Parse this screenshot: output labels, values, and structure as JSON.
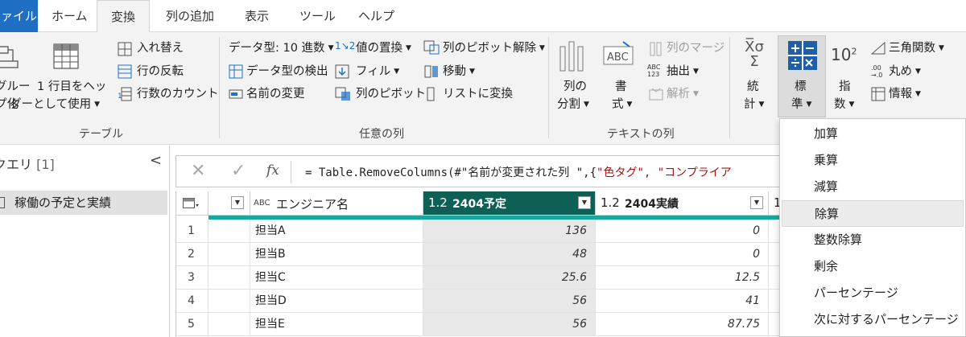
{
  "tabs": {
    "file": "ファイル",
    "home": "ホーム",
    "transform": "変換",
    "add_column": "列の追加",
    "view": "表示",
    "tools": "ツール",
    "help": "ヘルプ"
  },
  "ribbon": {
    "table_group": {
      "group_label": "テーブル",
      "group_rows_line1": "グルー",
      "group_rows_line2": "プ化",
      "use_first_row_line1": "1 行目をヘッ",
      "use_first_row_line2": "ダーとして使用",
      "transpose": "入れ替え",
      "reverse_rows": "行の反転",
      "count_rows": "行数のカウント"
    },
    "any_column_group": {
      "group_label": "任意の列",
      "data_type": "データ型: 10 進数",
      "detect_type": "データ型の検出",
      "rename": "名前の変更",
      "replace_values": "値の置換",
      "fill": "フィル",
      "pivot_column": "列のピボット",
      "unpivot": "列のピボット解除",
      "move": "移動",
      "convert_to_list": "リストに変換"
    },
    "text_column_group": {
      "group_label": "テキストの列",
      "split_line1": "列の",
      "split_line2": "分割",
      "format_line1": "書",
      "format_line2": "式",
      "merge_columns": "列のマージ",
      "extract": "抽出",
      "parse": "解析"
    },
    "number_group": {
      "stats_line1": "統",
      "stats_line2": "計",
      "standard_line1": "標",
      "standard_line2": "準",
      "sci_line1": "指",
      "sci_line2": "数",
      "trig": "三角関数",
      "rounding": "丸め",
      "information": "情報"
    }
  },
  "query_pane": {
    "title": "クエリ",
    "count": "[1]",
    "item": "稼働の予定と実績"
  },
  "formula_bar": {
    "cancel": "✕",
    "confirm": "✓",
    "fx": "fx",
    "prefix": "= Table.RemoveColumns(#\"名前が変更された列 \",{",
    "strings": "\"色タグ\", \"コンプライア"
  },
  "grid": {
    "columns": [
      {
        "type_icon": "ABC",
        "name": "エンジニア名"
      },
      {
        "type_icon": "1.2",
        "name": "2404予定"
      },
      {
        "type_icon": "1.2",
        "name": "2404実績"
      },
      {
        "type_icon": "1"
      }
    ],
    "rows": [
      {
        "n": "1",
        "engineer": "担当A",
        "plan": "136",
        "actual": "0"
      },
      {
        "n": "2",
        "engineer": "担当B",
        "plan": "48",
        "actual": "0"
      },
      {
        "n": "3",
        "engineer": "担当C",
        "plan": "25.6",
        "actual": "12.5"
      },
      {
        "n": "4",
        "engineer": "担当D",
        "plan": "56",
        "actual": "41"
      },
      {
        "n": "5",
        "engineer": "担当E",
        "plan": "56",
        "actual": "87.75"
      }
    ]
  },
  "menu": {
    "items": [
      "加算",
      "乗算",
      "減算",
      "除算",
      "整数除算",
      "剰余",
      "パーセンテージ",
      "次に対するパーセンテージ"
    ],
    "highlighted_index": 3
  },
  "colors": {
    "accent_blue": "#1f6fc5",
    "selected_header": "#0e5f56",
    "teal_band": "#1aa89e"
  }
}
